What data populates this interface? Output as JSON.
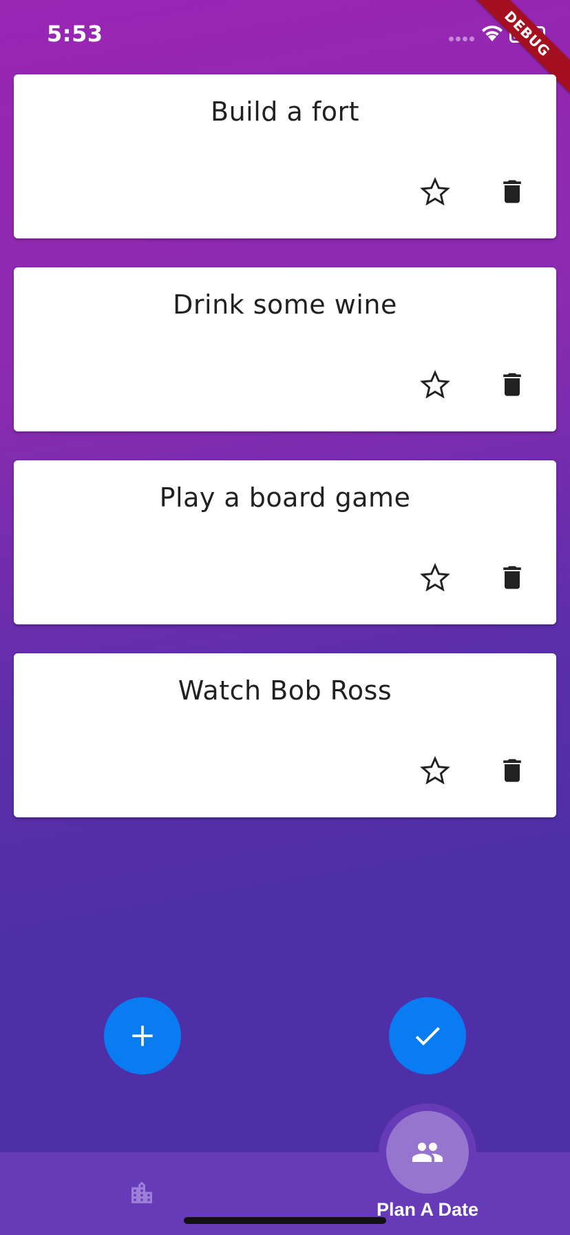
{
  "status_bar": {
    "time": "5:53"
  },
  "debug_banner": "DEBUG",
  "cards": [
    {
      "title": "Build a fort"
    },
    {
      "title": "Drink some wine"
    },
    {
      "title": "Play a board game"
    },
    {
      "title": "Watch Bob Ross"
    }
  ],
  "card_actions": {
    "favorite_icon": "star-outline-icon",
    "delete_icon": "trash-icon"
  },
  "fabs": {
    "add_icon": "plus-icon",
    "confirm_icon": "check-icon"
  },
  "bottom_nav": {
    "items": [
      {
        "icon": "city-icon",
        "label": ""
      },
      {
        "icon": "people-icon",
        "label": "Plan A Date",
        "active": true
      }
    ]
  },
  "colors": {
    "background_top": "#9a26b4",
    "background_bottom": "#4f2fa7",
    "fab": "#0a7cf2",
    "nav_bar": "#673ab7",
    "nav_active": "#9575cd",
    "debug": "#a51020"
  }
}
